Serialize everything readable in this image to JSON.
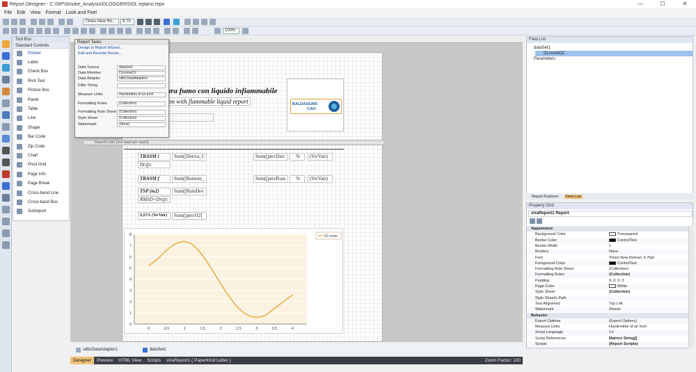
{
  "window": {
    "title": "Report Designer - C:\\SIP\\Smoke_Analysis\\DLOGGERS\\DL eptano.repx",
    "controls": [
      "—",
      "☐",
      "✕"
    ]
  },
  "menu": [
    "File",
    "Edit",
    "View",
    "Format",
    "Look and Feel"
  ],
  "toolbar": {
    "font_name": "Times New Ro...",
    "font_size": "9,75",
    "zoom": "100%"
  },
  "toolbox": {
    "title": "Tool Box",
    "section": "Standard Controls",
    "items": [
      "Pointer",
      "Label",
      "Check Box",
      "Rich Text",
      "Picture Box",
      "Panel",
      "Table",
      "Line",
      "Shape",
      "Bar Code",
      "Zip Code",
      "Chart",
      "Pivot Grid",
      "Page Info",
      "Page Break",
      "Cross-band Line",
      "Cross-band Box",
      "Subreport"
    ]
  },
  "report_tasks": {
    "title": "Report Tasks",
    "links": [
      "Design in Report Wizard...",
      "Edit and Reorder Bands..."
    ],
    "rows": [
      {
        "label": "Data Source",
        "value": "dataSet1"
      },
      {
        "label": "Data Member",
        "value": "DLnoiseO2"
      },
      {
        "label": "Data Adapter",
        "value": "sdbcDataAdapter1"
      },
      {
        "label": "Filter String",
        "value": ""
      },
      {
        "label": "Measure Units",
        "value": "Hundredths of an Inch"
      },
      {
        "label": "Formatting Rules",
        "value": "(Collection)"
      },
      {
        "label": "Formatting Rule Sheet",
        "value": "(Collection)"
      },
      {
        "label": "Style Sheet",
        "value": "(Collection)"
      },
      {
        "label": "Watermark",
        "value": "(None)"
      }
    ]
  },
  "report": {
    "title_it": "ura fumo con liquido infiammabile",
    "title_en": "on with flammable liquid report",
    "logo_line1": "BALDASSARI",
    "logo_line2": "CAVI",
    "band_label": "ReportFooter [one band per report]",
    "rows": [
      {
        "name": "TRASM i",
        "sub": "Dr@t",
        "expr": "Sum([Deriva_C",
        "perc": "Sum([percDeri",
        "unit": "%",
        "note": "(Vo/Vair)"
      },
      {
        "name": "TRASM f",
        "sub": "",
        "expr": "Sum([Rumore_",
        "perc": "Sum([percRum",
        "unit": "%",
        "note": "(Vo/Vair)"
      },
      {
        "name": "TSP (m2)",
        "sub": "RMSD+Dr@t",
        "expr": "Sum([RumDev",
        "perc": "",
        "unit": "",
        "note": ""
      },
      {
        "name": "0,01% (Vo/Vair)",
        "sub": "",
        "expr": "Sum([percO2]",
        "perc": "",
        "unit": "",
        "note": ""
      }
    ]
  },
  "chart_data": {
    "type": "line",
    "title": "",
    "xlabel": "",
    "ylabel": "",
    "xlim": [
      -0.4,
      4.4
    ],
    "ylim": [
      0,
      8
    ],
    "xticks": [
      "0",
      "0,5",
      "1",
      "1,5",
      "2",
      "2,5",
      "3",
      "3,5",
      "4"
    ],
    "yticks": [
      "0",
      "1",
      "2",
      "3",
      "4",
      "5",
      "6",
      "7",
      "8"
    ],
    "legend_position": "top-right",
    "series": [
      {
        "name": "O2 noise",
        "color": "#e8b04a",
        "x": [
          0,
          0.25,
          0.5,
          0.75,
          1,
          1.25,
          1.5,
          1.75,
          2,
          2.25,
          2.5,
          2.75,
          3,
          3.25,
          3.5,
          3.75,
          4
        ],
        "y": [
          5.2,
          5.8,
          6.6,
          7.15,
          7.35,
          7.0,
          6.1,
          4.9,
          3.6,
          2.4,
          1.4,
          0.8,
          0.6,
          0.8,
          1.4,
          2.0,
          2.6
        ]
      }
    ]
  },
  "bottom_tabs": [
    "sdbcDataAdapter1",
    "dataSet1"
  ],
  "status": {
    "views": [
      "Designer",
      "Preview",
      "HTML View",
      "Scripts"
    ],
    "doc": "xtraReport1 { PaperKind:Letter }",
    "zoom": "Zoom Factor: 100"
  },
  "field_list": {
    "title": "Field List",
    "items": [
      "dataSet1",
      "DLnoiseO2",
      "Parameters"
    ],
    "tabs": [
      "Report Explorer",
      "Field List"
    ]
  },
  "property_grid": {
    "title": "Property Grid",
    "object": "xtraReport1  Report",
    "rows": [
      {
        "cat": true,
        "key": "Appearance",
        "value": ""
      },
      {
        "key": "Background Color",
        "value": "Transparent",
        "swatch": "#ffffff"
      },
      {
        "key": "Border Color",
        "value": "ControlText",
        "swatch": "#000000"
      },
      {
        "key": "Border Width",
        "value": "1"
      },
      {
        "key": "Borders",
        "value": "None"
      },
      {
        "key": "Font",
        "value": "Times New Roman; 9,75pt"
      },
      {
        "key": "Foreground Color",
        "value": "ControlText",
        "swatch": "#000000"
      },
      {
        "key": "Formatting Rule Sheet",
        "value": "(Collection)"
      },
      {
        "key": "Formatting Rules",
        "value": "(Collection)",
        "bold": true
      },
      {
        "key": "Padding",
        "value": "0; 0; 0; 0"
      },
      {
        "key": "Page Color",
        "value": "White",
        "swatch": "#ffffff"
      },
      {
        "key": "Style Sheet",
        "value": "(Collection)",
        "bold": true
      },
      {
        "key": "Style Sheet's Path",
        "value": ""
      },
      {
        "key": "Text Alignment",
        "value": "Top Left"
      },
      {
        "key": "Watermark",
        "value": "(None)"
      },
      {
        "cat": true,
        "key": "Behavior",
        "value": ""
      },
      {
        "key": "Export Options",
        "value": "(Export Options)"
      },
      {
        "key": "Measure Units",
        "value": "Hundredths of an Inch"
      },
      {
        "key": "Script Language",
        "value": "C#"
      },
      {
        "key": "Script References",
        "value": "Matrice String[]",
        "bold": true
      },
      {
        "key": "Scripts",
        "value": "(Report Scripts)",
        "bold": true
      }
    ]
  }
}
